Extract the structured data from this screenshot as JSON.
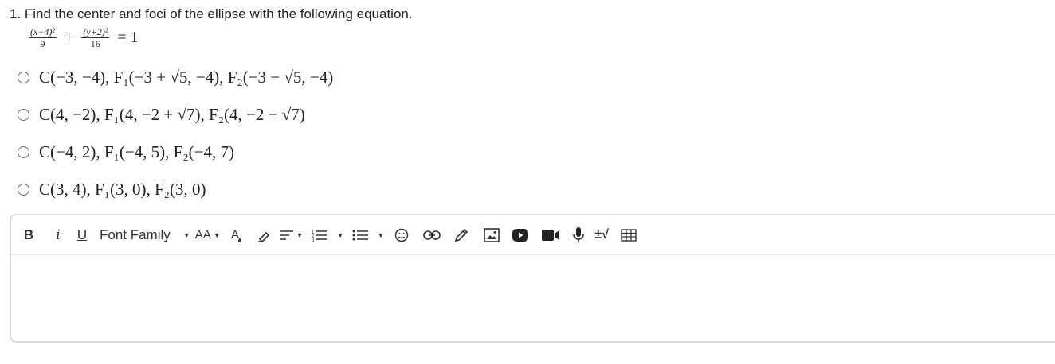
{
  "question": {
    "text": "1. Find the center and foci of the ellipse with the following equation.",
    "equation": {
      "frac1_num": "(x−4)²",
      "frac1_den": "9",
      "plus": "+",
      "frac2_num": "(y+2)²",
      "frac2_den": "16",
      "rhs": "= 1"
    }
  },
  "options": [
    {
      "label": "C(−3, −4), F₁(−3 + √5, −4), F₂(−3 − √5, −4)"
    },
    {
      "label": "C(4, −2), F₁(4, −2 + √7), F₂(4, −2 − √7)"
    },
    {
      "label": "C(−4, 2), F₁(−4, 5), F₂(−4, 7)"
    },
    {
      "label": "C(3, 4), F₁(3, 0), F₂(3, 0)"
    }
  ],
  "toolbar": {
    "bold": "B",
    "italic": "i",
    "underline": "U",
    "font_family": "Font Family",
    "font_size": "AA",
    "equation_tool": "±√"
  },
  "icons": {
    "bold": "bold-icon",
    "italic": "italic-icon",
    "underline": "underline-icon",
    "font_color": "font-color-icon",
    "highlight": "highlight-icon",
    "align": "align-icon",
    "ordered_list": "ordered-list-icon",
    "unordered_list": "unordered-list-icon",
    "emoji": "emoji-icon",
    "link": "link-icon",
    "draw": "pencil-icon",
    "image": "image-icon",
    "youtube": "youtube-icon",
    "video": "video-camera-icon",
    "mic": "microphone-icon",
    "equation": "equation-icon",
    "table": "table-icon"
  }
}
